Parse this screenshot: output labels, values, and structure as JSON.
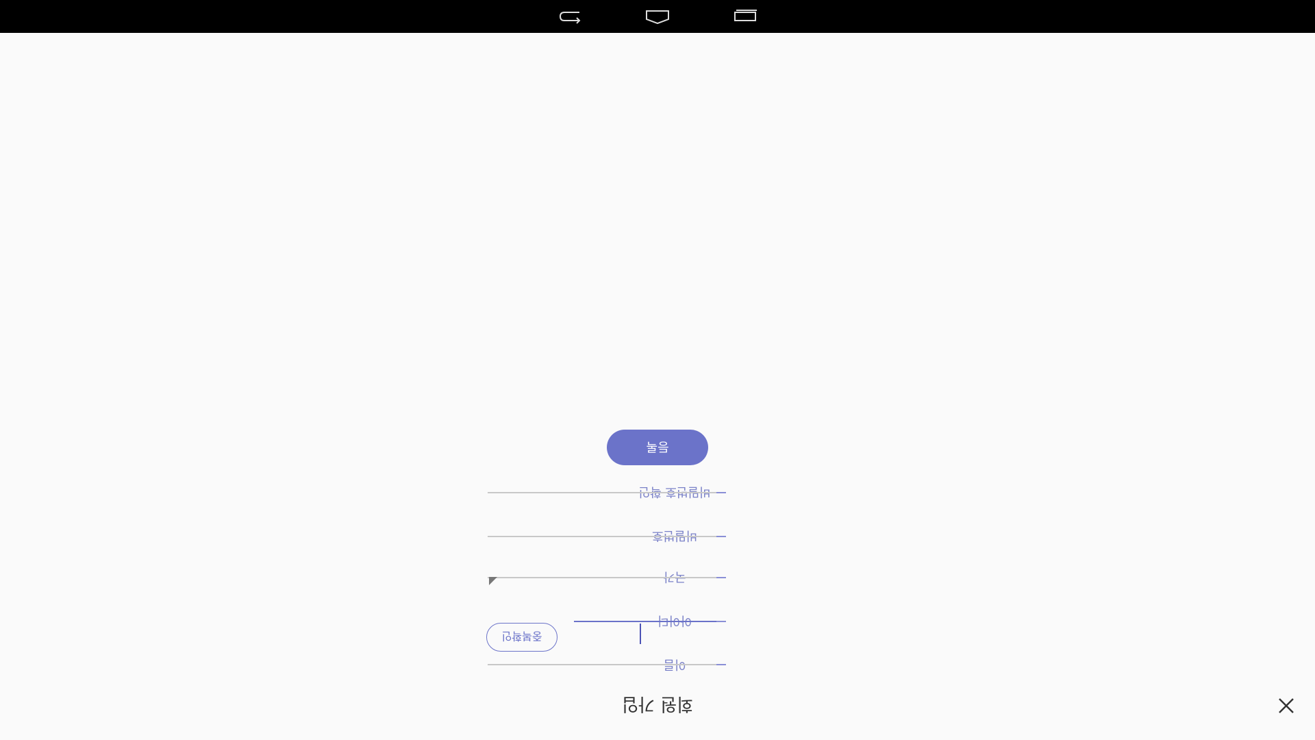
{
  "header": {
    "title": "회원 가입"
  },
  "form": {
    "name_label": "이름",
    "id_label": "아이디",
    "check_duplicate_label": "중복확인",
    "country_label": "국가",
    "password_label": "비밀번호",
    "password_confirm_label": "비밀번호 확인"
  },
  "actions": {
    "submit_label": "등록"
  },
  "navigation": {
    "back_icon": "back-icon",
    "home_icon": "home-icon",
    "recents_icon": "recents-icon"
  },
  "colors": {
    "accent": "#6b73c9",
    "nav_bg": "#000000",
    "background": "#fafafa"
  }
}
